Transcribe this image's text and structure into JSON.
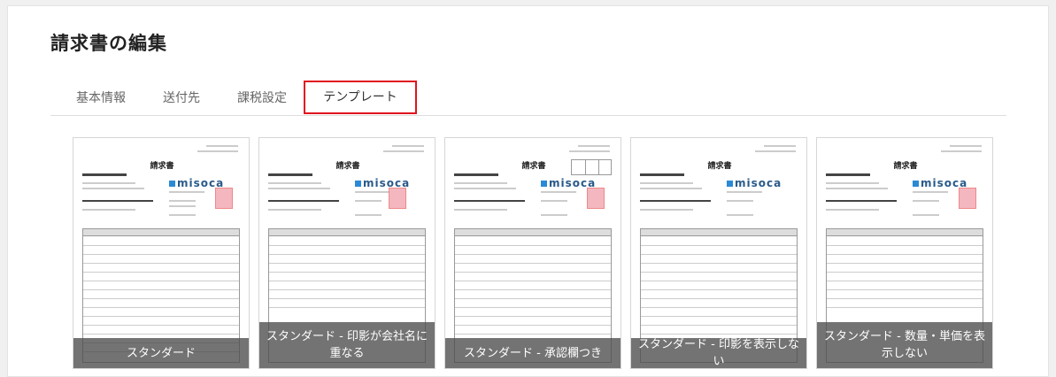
{
  "page": {
    "title": "請求書の編集"
  },
  "tabs": [
    {
      "label": "基本情報",
      "active": false
    },
    {
      "label": "送付先",
      "active": false
    },
    {
      "label": "課税設定",
      "active": false
    },
    {
      "label": "テンプレート",
      "active": true
    }
  ],
  "preview": {
    "doc_title": "請求書",
    "brand": "misoca"
  },
  "templates": [
    {
      "caption": "スタンダード"
    },
    {
      "caption": "スタンダード - 印影が会社名に重なる"
    },
    {
      "caption": "スタンダード - 承認欄つき"
    },
    {
      "caption": "スタンダード - 印影を表示しない"
    },
    {
      "caption": "スタンダード - 数量・単価を表示しない"
    }
  ],
  "colors": {
    "active_tab_border": "#e0141e",
    "caption_bg": "#4b4b4b"
  }
}
